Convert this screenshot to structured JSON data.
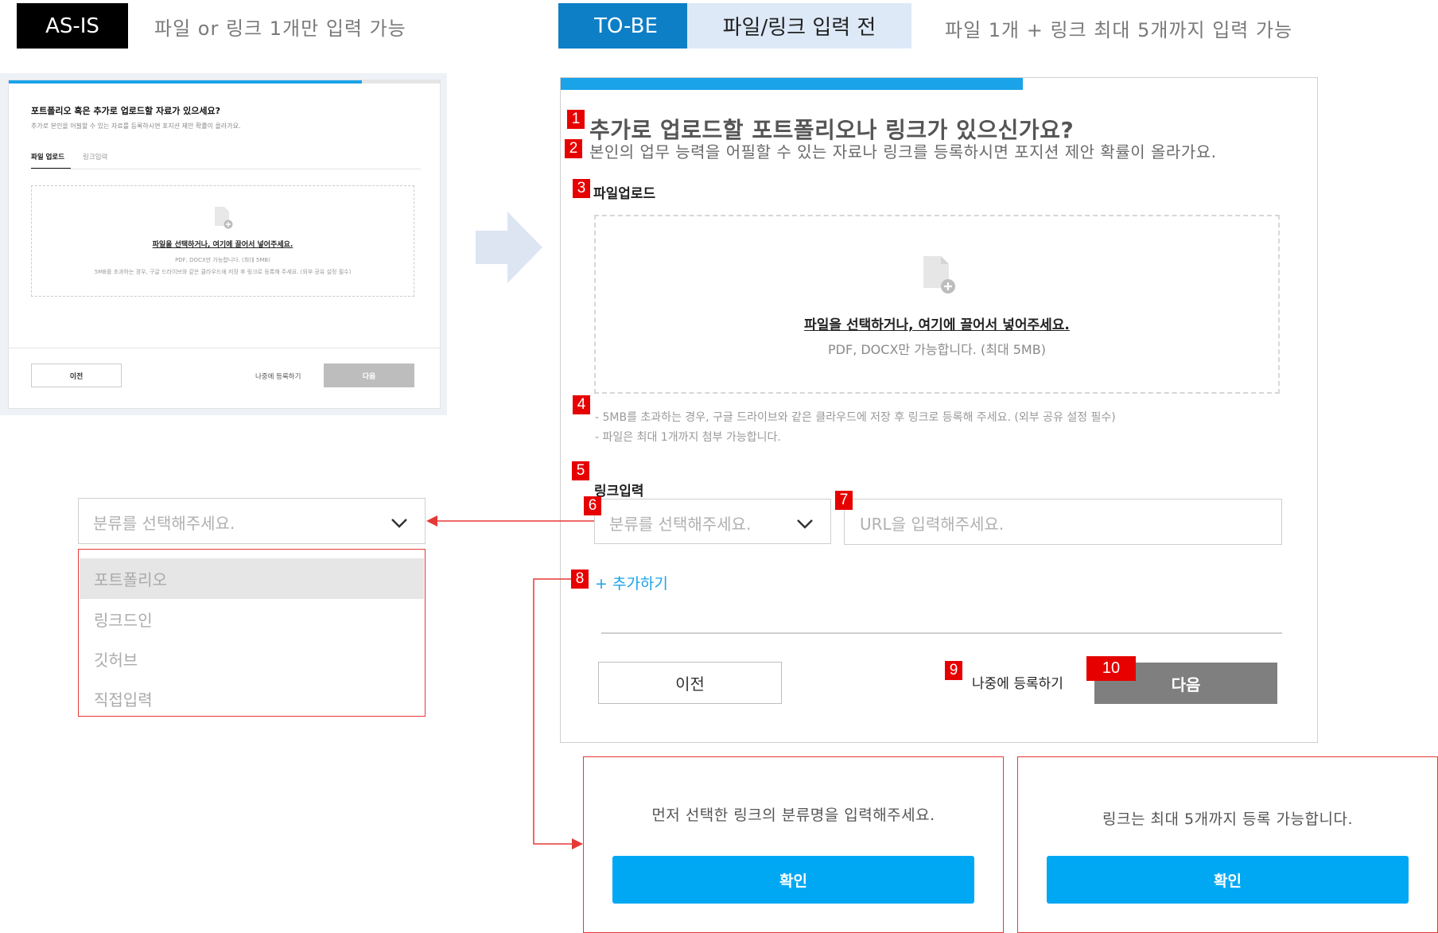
{
  "header": {
    "asis_tag": "AS-IS",
    "asis_desc": "파일 or 링크 1개만 입력 가능",
    "tobe_tag": "TO-BE",
    "tobe_state": "파일/링크 입력 전",
    "tobe_desc": "파일 1개 + 링크 최대 5개까지 입력 가능"
  },
  "asis": {
    "title": "포트폴리오 혹은 추가로 업로드할 자료가 있으세요?",
    "subtitle": "추가로 본인을 어필할 수 있는 자료를 등록하시면 포지션 제안 확률이 올라가요.",
    "tabs": [
      "파일 업로드",
      "링크입력"
    ],
    "drop_main": "파일을 선택하거나, 여기에 끌어서 넣어주세요.",
    "drop_sub": "PDF, DOCX만 가능합니다. (최대 5MB)",
    "drop_note": "5MB를 초과하는 경우, 구글 드라이브와 같은 클라우드에 저장 후 링크로 등록해 주세요. (외부 공유 설정 필수)",
    "prev": "이전",
    "later": "나중에 등록하기",
    "next": "다음"
  },
  "tobe": {
    "badges": [
      "1",
      "2",
      "3",
      "4",
      "5",
      "6",
      "7",
      "8",
      "9",
      "10"
    ],
    "title": "추가로 업로드할 포트폴리오나 링크가 있으신가요?",
    "subtitle": "본인의 업무 능력을 어필할 수 있는 자료나 링크를 등록하시면 포지션 제안 확률이 올라가요.",
    "file_label": "파일업로드",
    "drop_main": "파일을 선택하거나, 여기에 끌어서 넣어주세요.",
    "drop_sub": "PDF, DOCX만 가능합니다. (최대 5MB)",
    "note1": "- 5MB를 초과하는 경우, 구글 드라이브와 같은 클라우드에 저장 후 링크로 등록해 주세요. (외부 공유 설정 필수)",
    "note2": "- 파일은 최대 1개까지 첨부 가능합니다.",
    "link_label": "링크입력",
    "category_placeholder": "분류를 선택해주세요.",
    "url_placeholder": "URL을 입력해주세요.",
    "add": "+ 추가하기",
    "prev": "이전",
    "later": "나중에 등록하기",
    "next": "다음"
  },
  "dropdown": {
    "placeholder": "분류를 선택해주세요.",
    "options": [
      "포트폴리오",
      "링크드인",
      "깃허브",
      "직접입력"
    ]
  },
  "popups": [
    {
      "message": "먼저 선택한 링크의 분류명을 입력해주세요.",
      "confirm": "확인"
    },
    {
      "message": "링크는 최대 5개까지 등록 가능합니다.",
      "confirm": "확인"
    }
  ],
  "colors": {
    "accent_blue": "#00a8f3",
    "tobe_tag": "#0d7fc7",
    "badge_red": "#e60000",
    "progress": "#1aa3e8",
    "disabled_btn": "#7f7f7f"
  },
  "progress": {
    "asis": 0.82,
    "tobe": 0.6
  }
}
